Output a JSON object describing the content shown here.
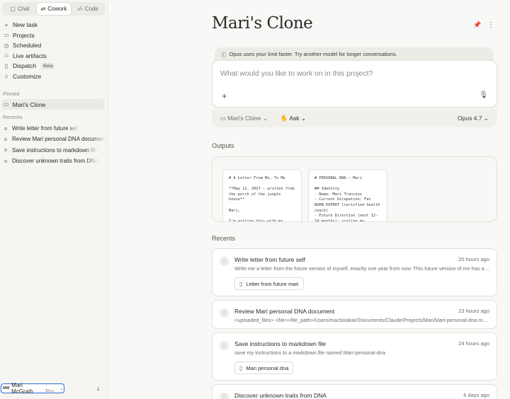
{
  "sidebar": {
    "modes": [
      {
        "label": "Chat",
        "icon": "chat-icon",
        "active": false
      },
      {
        "label": "Cowork",
        "icon": "cowork-icon",
        "active": true
      },
      {
        "label": "Code",
        "icon": "code-icon",
        "active": false
      }
    ],
    "nav": [
      {
        "label": "New task",
        "icon": "plus-icon"
      },
      {
        "label": "Projects",
        "icon": "folder-icon"
      },
      {
        "label": "Scheduled",
        "icon": "clock-icon"
      },
      {
        "label": "Live artifacts",
        "icon": "artifacts-icon"
      },
      {
        "label": "Dispatch",
        "icon": "phone-icon",
        "badge": "Beta"
      },
      {
        "label": "Customize",
        "icon": "briefcase-icon"
      }
    ],
    "pinned_label": "Pinned",
    "pinned": [
      {
        "label": "Mari's Clone",
        "icon": "folder-icon"
      }
    ],
    "recents_label": "Recents",
    "recents": [
      "Write letter from future self",
      "Review Mari personal DNA document",
      "Save instructions to markdown file",
      "Discover unknown traits from DNA"
    ],
    "user": {
      "initials": "MM",
      "name": "Mari McGrath",
      "plan": "· Pro"
    }
  },
  "main": {
    "title": "Mari's Clone",
    "notice": "Opus uses your limit faster. Try another model for longer conversations.",
    "composer": {
      "placeholder": "What would you like to work on in this project?"
    },
    "toolbar": {
      "project": "Mari's Clone",
      "mode": "Ask",
      "model": "Opus 4.7"
    },
    "outputs_label": "Outputs",
    "outputs": [
      {
        "content": "# A Letter From Me, To Me\n\n**May 12, 2027 — written from the porch of the jungle house**\n\nMari,\n\nI'm writing this with my"
      },
      {
        "content": "# PERSONAL DNA — Mari\n\n## Identity\n- Name: Mari Troncoso\n- Current Occupation: Fat BURN EXPERT (certified health coach)\n- Future Direction (next 12-24 months): scaling my"
      }
    ],
    "recents_label": "Recents",
    "recents": [
      {
        "title": "Write letter from future self",
        "time": "20 hours ago",
        "desc": "Write me a letter from the future version of myself, exactly one year from now. This future version of me has achieved",
        "attachment": "Letter from future mari"
      },
      {
        "title": "Review Mari personal DNA document",
        "time": "23 hours ago",
        "desc": "<uploaded_files> <file><file_path>/Users/macbookair/Documents/Claude/Projects/Mari/Mari-personal-dna.md</file_path>"
      },
      {
        "title": "Save instructions to markdown file",
        "time": "24 hours ago",
        "desc": "save my instructions to a markdown file named Mari-personal-dna",
        "attachment": "Mari personal dna"
      },
      {
        "title": "Discover unknown traits from DNA",
        "time": "6 days ago"
      }
    ]
  }
}
